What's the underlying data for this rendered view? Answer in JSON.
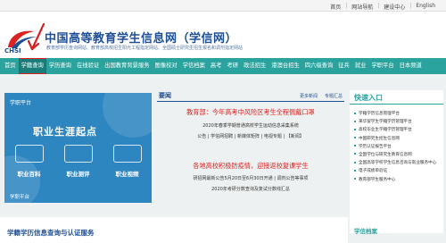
{
  "topbar": {
    "links": [
      "首页",
      "网站导航",
      "建设中心",
      "English"
    ]
  },
  "header": {
    "logo_text": "CHSI",
    "title": "中国高等教育学生信息网（学信网）",
    "subtitle": "教育部学历查询网站、教育部高校招生阳光工程指定网站、全国硕士研究生招生报名和调剂指定网站"
  },
  "nav": {
    "items": [
      "首页",
      "学籍查询",
      "学历查询",
      "在线验证",
      "出国教育背景服务",
      "图像校对",
      "学信档案",
      "高考",
      "考研",
      "政法招生",
      "港澳台招生",
      "四六级查询",
      "征兵",
      "就业",
      "学职平台",
      "日本频道"
    ],
    "active_index": 1
  },
  "left_panel": {
    "header": "学职平台",
    "title": "职业生涯起点",
    "items": [
      "职业百科",
      "职业测评",
      "职业视频"
    ],
    "footer": "学职平台"
  },
  "center": {
    "section_label": "要闻",
    "more": "更多新闻",
    "topic": "专题汇总",
    "headline1": "教育部：今年高考中风险区考生全程佩戴口罩",
    "line1": "2020年春季学期普通高校学生运动信息采集系统",
    "line2": "公告 | 学信网招聘 | 新媒体矩阵 | 电视专题 | 【新闻】",
    "headline2": "各地高校积极防疫情，迎接返校复课学生",
    "line3": "研招网最新公告5月20日至6月30日开通 | 调剂公告等事项",
    "line4": "2020年考研分数查询及复试分数线汇总"
  },
  "right_panel": {
    "header": "快速入口",
    "items": [
      "学籍学历信息管理平台",
      "来华留学生学籍学历管理平台",
      "高校毕业生学籍学历管理平台",
      "中国研究生招生信息网",
      "学历认证报告平台",
      "全国学位与研究生教育信息网",
      "全国高等学校学生信息咨询与就业服务中心",
      "电子成绩单验证",
      "教育部学生服务中心"
    ]
  },
  "bottom": {
    "section_label": "学籍学历信息查询与认证服务",
    "right_label": "学信档案"
  },
  "colors": {
    "nav": "#2aa39f",
    "brand": "#1f4f96",
    "highlight": "#d72020"
  }
}
